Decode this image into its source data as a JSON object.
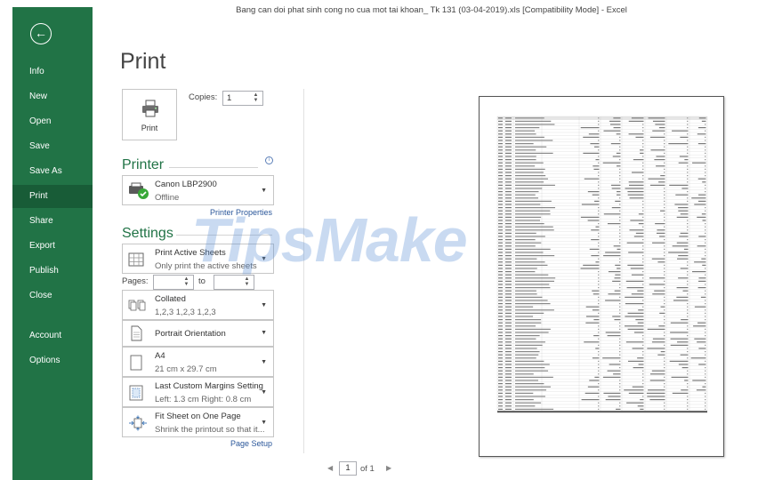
{
  "window": {
    "title": "Bang can doi phat sinh cong no cua mot tai khoan_ Tk 131 (03-04-2019).xls  [Compatibility Mode]  -  Excel"
  },
  "sidebar": {
    "back_icon": "arrow-left-icon",
    "items": [
      {
        "label": "Info"
      },
      {
        "label": "New"
      },
      {
        "label": "Open"
      },
      {
        "label": "Save"
      },
      {
        "label": "Save As"
      },
      {
        "label": "Print"
      },
      {
        "label": "Share"
      },
      {
        "label": "Export"
      },
      {
        "label": "Publish"
      },
      {
        "label": "Close"
      },
      {
        "label": "Account"
      },
      {
        "label": "Options"
      }
    ],
    "active": "Print",
    "color": "#217346",
    "active_color": "#185c37"
  },
  "print": {
    "title": "Print",
    "button_label": "Print",
    "copies_label": "Copies:",
    "copies_value": "1"
  },
  "printer": {
    "header": "Printer",
    "name": "Canon LBP2900",
    "status": "Offline",
    "properties_link": "Printer Properties",
    "info_icon": "info-icon"
  },
  "settings": {
    "header": "Settings",
    "active_sheets": {
      "main": "Print Active Sheets",
      "sub": "Only print the active sheets"
    },
    "pages_label": "Pages:",
    "to_label": "to",
    "pages_from": "",
    "pages_to": "",
    "collated": {
      "main": "Collated",
      "sub": "1,2,3    1,2,3    1,2,3"
    },
    "orientation": {
      "main": "Portrait Orientation"
    },
    "paper": {
      "main": "A4",
      "sub": "21 cm x 29.7 cm"
    },
    "margins": {
      "main": "Last Custom Margins Setting",
      "sub": "Left:  1.3 cm    Right:  0.8 cm"
    },
    "scaling": {
      "main": "Fit Sheet on One Page",
      "sub": "Shrink the printout so that it..."
    },
    "page_setup_link": "Page Setup"
  },
  "preview": {
    "current_page": "1",
    "of_label": "of 1"
  },
  "watermark": {
    "text": "TipsMake"
  }
}
